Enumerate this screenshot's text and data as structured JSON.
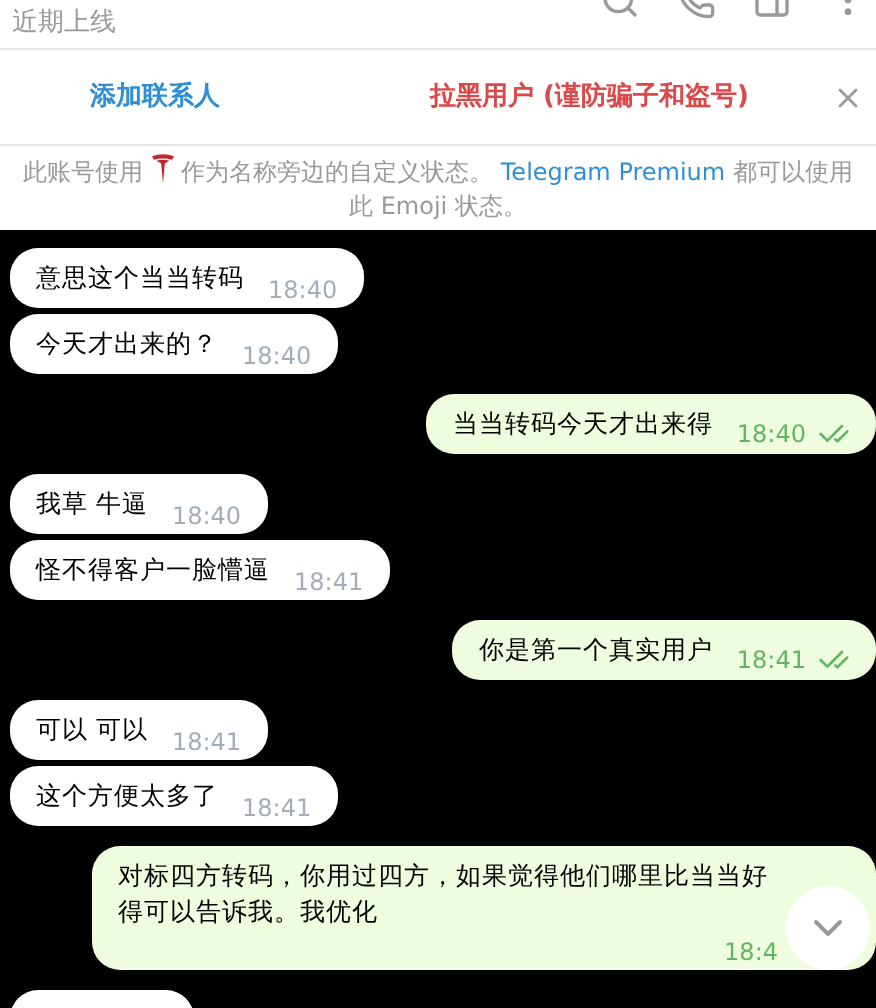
{
  "header": {
    "status": "近期上线"
  },
  "actions": {
    "add_contact": "添加联系人",
    "block": "拉黑用户 (谨防骗子和盗号)"
  },
  "notice": {
    "before": "此账号使用",
    "after": "作为名称旁边的自定义状态。",
    "link": "Telegram Premium",
    "end": "都可以使用此 Emoji 状态。"
  },
  "messages": [
    {
      "kind": "incoming",
      "text": "意思这个当当转码",
      "time": "18:40"
    },
    {
      "kind": "incoming",
      "text": "今天才出来的？",
      "time": "18:40"
    },
    {
      "kind": "outgoing",
      "text": "当当转码今天才出来得",
      "time": "18:40",
      "read": true
    },
    {
      "kind": "incoming",
      "text": "我草  牛逼",
      "time": "18:40"
    },
    {
      "kind": "incoming",
      "text": "怪不得客户一脸懵逼",
      "time": "18:41"
    },
    {
      "kind": "outgoing",
      "text": "你是第一个真实用户",
      "time": "18:41",
      "read": true
    },
    {
      "kind": "incoming",
      "text": "可以  可以",
      "time": "18:41"
    },
    {
      "kind": "incoming",
      "text": "这个方便太多了",
      "time": "18:41"
    },
    {
      "kind": "outgoing",
      "text": "对标四方转码，你用过四方，如果觉得他们哪里比当当好得可以告诉我。我优化",
      "time": "18:4"
    },
    {
      "kind": "incoming_cut"
    }
  ]
}
